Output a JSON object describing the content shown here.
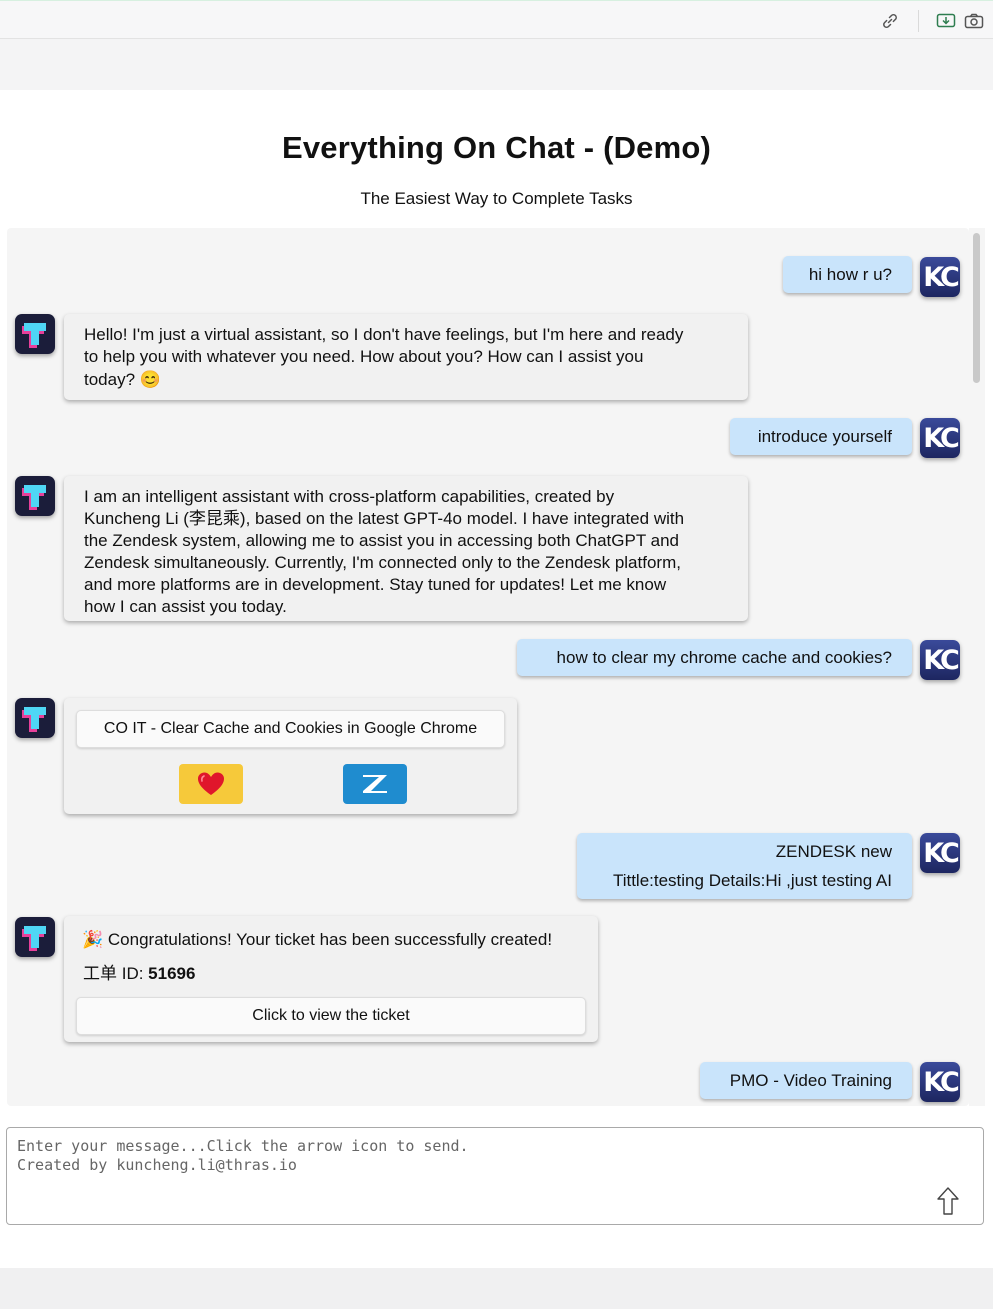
{
  "toolbar": {
    "icons": [
      "link-icon",
      "download-image-icon",
      "camera-icon"
    ]
  },
  "header": {
    "title": "Everything On Chat - (Demo)",
    "subtitle": "The Easiest Way to Complete Tasks"
  },
  "user_avatar_initials": "KC",
  "messages": {
    "m1": {
      "from": "user",
      "text": "hi how r u?"
    },
    "m2": {
      "from": "bot",
      "lines": [
        "Hello! I'm just a virtual assistant, so I don't have feelings, but I'm here and ready",
        "to help you with whatever you need. How about you? How can I assist you",
        "today? 😊"
      ]
    },
    "m3": {
      "from": "user",
      "text": "introduce yourself"
    },
    "m4": {
      "from": "bot",
      "lines": [
        "I am an intelligent assistant with cross-platform capabilities, created by",
        "Kuncheng Li (李昆乘), based on the latest GPT-4o model. I have integrated with",
        "the Zendesk system, allowing me to assist you in accessing both ChatGPT and",
        "Zendesk simultaneously. Currently, I'm connected only to the Zendesk platform,",
        "and more platforms are in development. Stay tuned for updates! Let me know",
        "how I can assist you today."
      ]
    },
    "m5": {
      "from": "user",
      "text": "how to clear my chrome cache and cookies?"
    },
    "m6": {
      "from": "bot",
      "card_title": "CO IT - Clear Cache and Cookies in Google Chrome",
      "buttons": [
        "heart-icon",
        "zendesk-icon"
      ]
    },
    "m7": {
      "from": "user",
      "line1": "ZENDESK new",
      "line2": "Tittle:testing Details:Hi ,just testing AI"
    },
    "m8": {
      "from": "bot",
      "congrats": "🎉 Congratulations! Your ticket has been successfully created!",
      "id_label": "工单 ID: ",
      "id_value": "51696",
      "view_button": "Click to view the ticket"
    },
    "m9": {
      "from": "user",
      "text": "PMO - Video Training"
    }
  },
  "composer": {
    "placeholder": "Enter your message...Click the arrow icon to send.\nCreated by kuncheng.li@thras.io",
    "send_icon": "arrow-up-icon"
  }
}
